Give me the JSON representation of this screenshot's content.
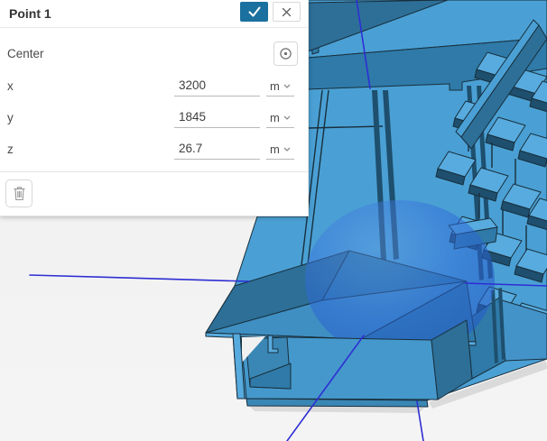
{
  "dialog": {
    "title": "Point 1",
    "section_label": "Center",
    "rows": [
      {
        "label": "x",
        "value": "3200",
        "unit": "m"
      },
      {
        "label": "y",
        "value": "1845",
        "unit": "m"
      },
      {
        "label": "z",
        "value": "26.7",
        "unit": "m"
      }
    ],
    "icons": {
      "confirm": "check-icon",
      "close": "x-icon",
      "center_picker": "target-icon",
      "delete": "trash-icon",
      "unit_dropdown": "chevron-down-icon"
    }
  },
  "viewport": {
    "scene_elements": [
      "building-model",
      "selection-sphere",
      "axis-lines"
    ]
  },
  "colors": {
    "accent_blue": "#1a709e",
    "axis_blue": "#2e2ed4",
    "bg_gray": "#f1f1f1",
    "model_light": "#4aa0d4",
    "model_light2": "#58abde",
    "model_mid": "#3a87b5",
    "model_mid2": "#2f7aa8",
    "model_front": "#4493c8",
    "model_front2": "#3f8fc3",
    "model_dark": "#2d6f97",
    "model_dark2": "#1e4f6e",
    "wall": "#4598cb",
    "outline": "#182f3d",
    "selection_sphere_blue": "#2b63d6"
  }
}
